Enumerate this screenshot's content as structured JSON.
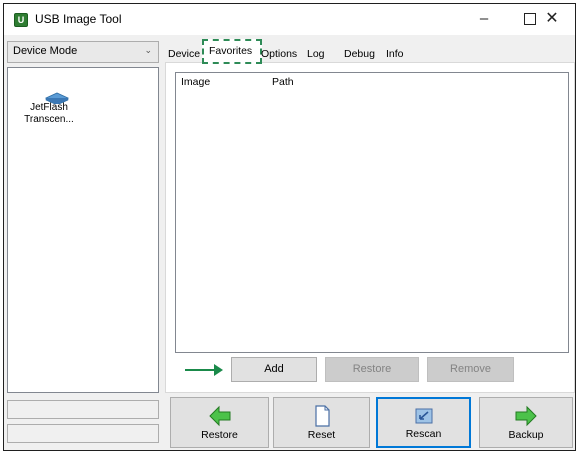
{
  "window": {
    "title": "USB Image Tool",
    "app_icon_letter": "U",
    "controls": {
      "minimize": "–",
      "close": "✕"
    }
  },
  "sidebar": {
    "mode_select": {
      "value": "Device Mode"
    },
    "devices": [
      {
        "name": "JetFlash\nTranscen...",
        "icon": "usb-drive-icon"
      }
    ]
  },
  "tabs": [
    {
      "label": "Device",
      "active": false
    },
    {
      "label": "Favorites",
      "active": true
    },
    {
      "label": "Options",
      "active": false
    },
    {
      "label": "Log",
      "active": false
    },
    {
      "label": "Debug",
      "active": false
    },
    {
      "label": "Info",
      "active": false
    }
  ],
  "favorites": {
    "columns": [
      "Image",
      "Path"
    ],
    "rows": [],
    "buttons": {
      "add": "Add",
      "restore": "Restore",
      "remove": "Remove"
    }
  },
  "toolbar": {
    "restore": "Restore",
    "reset": "Reset",
    "rescan": "Rescan",
    "backup": "Backup"
  },
  "colors": {
    "annotation_green": "#2e8b57",
    "arrow_green": "#1a8a4a",
    "focus_blue": "#0078d7"
  }
}
